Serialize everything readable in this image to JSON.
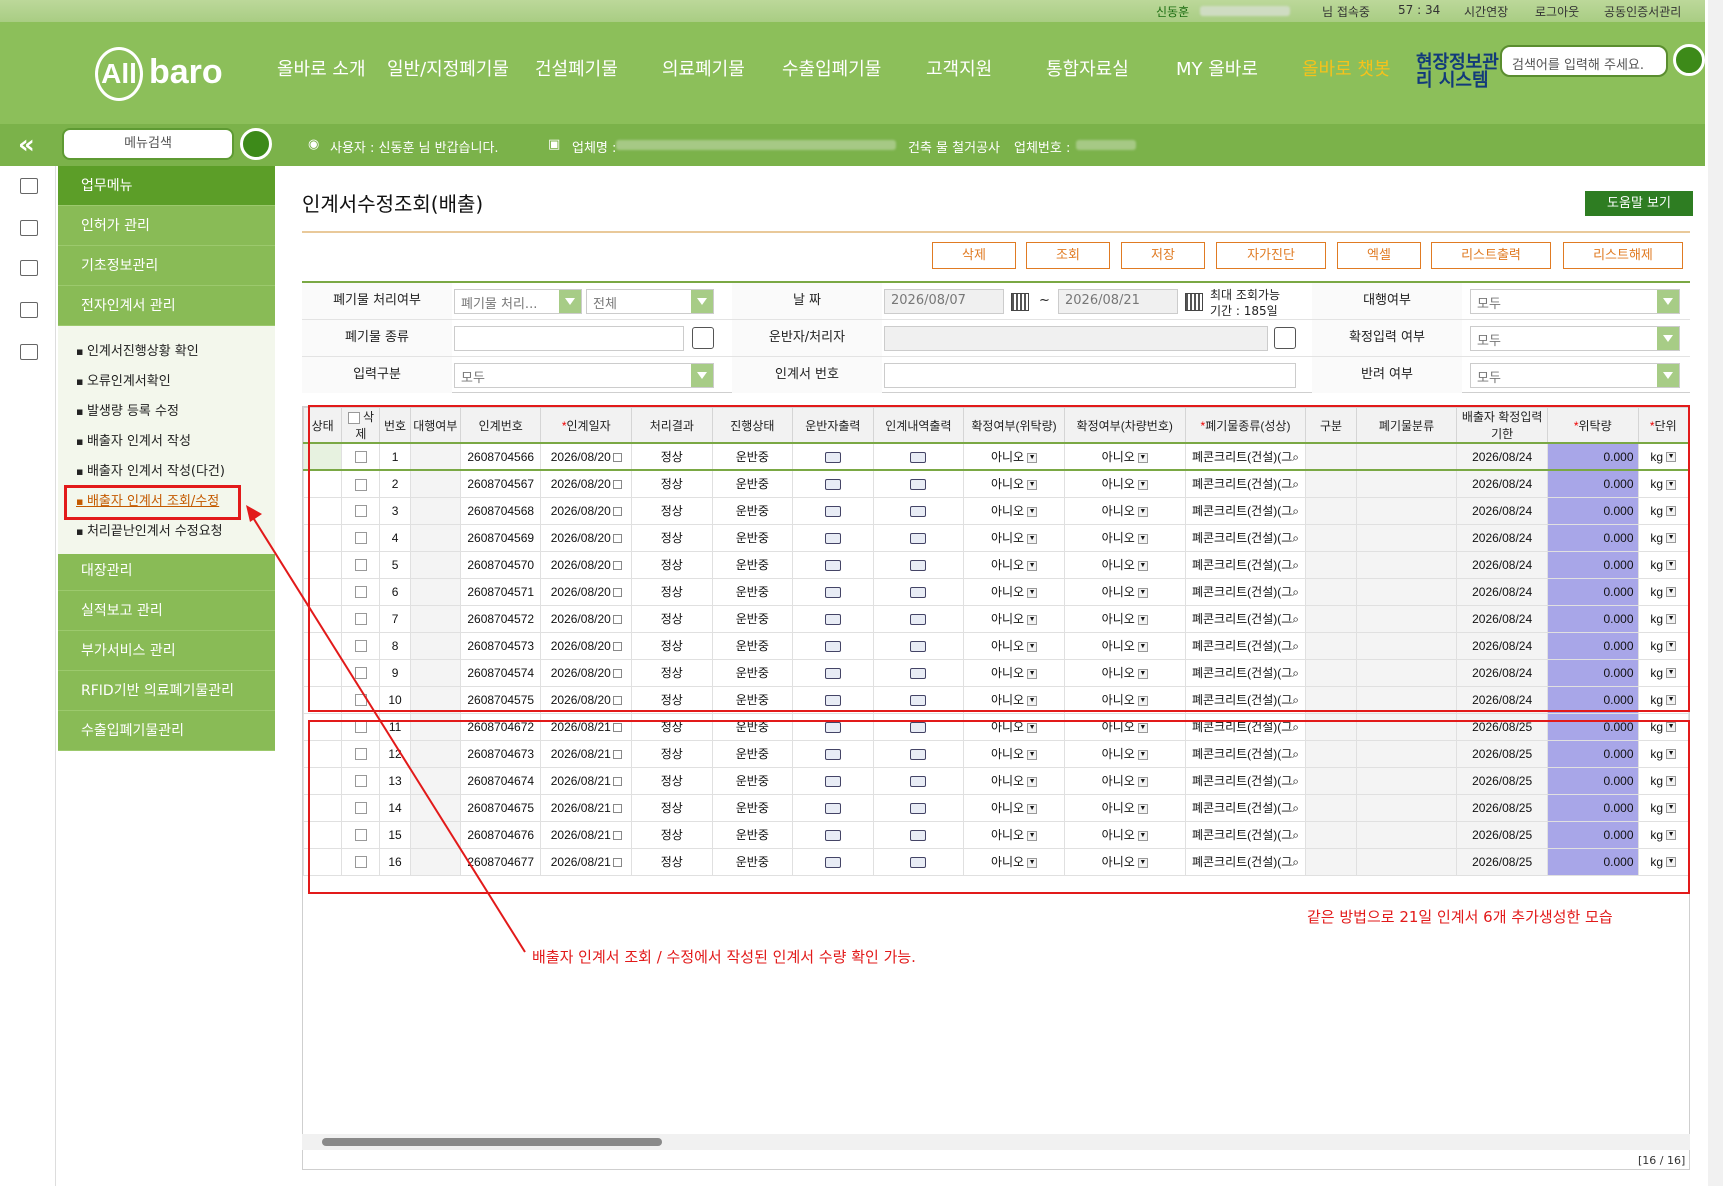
{
  "topbar": {
    "user": "신동훈",
    "status": "님 접속중",
    "timer": "57 : 34",
    "extend": "시간연장",
    "logout": "로그아웃",
    "cert": "공동인증서관리"
  },
  "logo": {
    "text": "baro",
    "mark": "All"
  },
  "nav": [
    "올바로 소개",
    "일반/지정폐기물",
    "건설폐기물",
    "의료폐기물",
    "수출입폐기물",
    "고객지원",
    "통합자료실",
    "MY 올바로",
    "올바로 챗봇",
    "현장정보관리 시스템"
  ],
  "search": {
    "placeholder": "검색어를 입력해 주세요."
  },
  "subbar": {
    "menu_search": "메뉴검색",
    "user_label": "사용자 : 신동훈 님 반갑습니다.",
    "company_label": "업체명 :",
    "company_tail": "건축 물 철거공사",
    "bizno_label": "업체번호 :"
  },
  "leftmenu": {
    "head": "업무메뉴",
    "items": [
      "인허가 관리",
      "기초정보관리",
      "전자인계서 관리"
    ],
    "sub": [
      "인계서진행상황 확인",
      "오류인계서확인",
      "발생량 등록 수정",
      "배출자 인계서 작성",
      "배출자 인계서 작성(다건)",
      "배출자 인계서 조회/수정",
      "처리끝난인계서 수정요청"
    ],
    "bottom": [
      "대장관리",
      "실적보고 관리",
      "부가서비스 관리",
      "RFID기반 의료폐기물관리",
      "수출입폐기물관리"
    ]
  },
  "page": {
    "title": "인계서수정조회(배출)",
    "help": "도움말 보기"
  },
  "actions": [
    "삭제",
    "조회",
    "저장",
    "자가진단",
    "엑셀",
    "리스트출력",
    "리스트해제"
  ],
  "filters": {
    "row1": {
      "l1": "폐기물 처리여부",
      "v1": "폐기물 처리...",
      "v1b": "전체",
      "l2": "날 짜",
      "date_from": "2026/08/07",
      "tilde": "~",
      "date_to": "2026/08/21",
      "max_period": "최대 조회가능",
      "max_period2": "기간 : 185일",
      "l3": "대행여부",
      "v3": "모두"
    },
    "row2": {
      "l1": "폐기물 종류",
      "l2": "운반자/처리자",
      "l3": "확정입력 여부",
      "v3": "모두"
    },
    "row3": {
      "l1": "입력구분",
      "v1": "모두",
      "l2": "인계서 번호",
      "l3": "반려 여부",
      "v3": "모두"
    }
  },
  "grid": {
    "headers": [
      "상태",
      "삭제",
      "번호",
      "대행여부",
      "인계번호",
      "인계일자",
      "처리결과",
      "진행상태",
      "운반자출력",
      "인계내역출력",
      "확정여부(위탁량)",
      "확정여부(차량번호)",
      "폐기물종류(성상)",
      "구분",
      "폐기물분류",
      "배출자 확정입력기한",
      "위탁량",
      "단위"
    ],
    "required_mark": "*",
    "rows": [
      {
        "no": "1",
        "id": "2608704566",
        "date": "2026/08/20",
        "result": "정상",
        "state": "운반중",
        "c1": "아니오",
        "c2": "아니오",
        "waste": "폐콘크리트(건설)(그",
        "deadline": "2026/08/24",
        "qty": "0.000",
        "unit": "kg"
      },
      {
        "no": "2",
        "id": "2608704567",
        "date": "2026/08/20",
        "result": "정상",
        "state": "운반중",
        "c1": "아니오",
        "c2": "아니오",
        "waste": "폐콘크리트(건설)(그",
        "deadline": "2026/08/24",
        "qty": "0.000",
        "unit": "kg"
      },
      {
        "no": "3",
        "id": "2608704568",
        "date": "2026/08/20",
        "result": "정상",
        "state": "운반중",
        "c1": "아니오",
        "c2": "아니오",
        "waste": "폐콘크리트(건설)(그",
        "deadline": "2026/08/24",
        "qty": "0.000",
        "unit": "kg"
      },
      {
        "no": "4",
        "id": "2608704569",
        "date": "2026/08/20",
        "result": "정상",
        "state": "운반중",
        "c1": "아니오",
        "c2": "아니오",
        "waste": "폐콘크리트(건설)(그",
        "deadline": "2026/08/24",
        "qty": "0.000",
        "unit": "kg"
      },
      {
        "no": "5",
        "id": "2608704570",
        "date": "2026/08/20",
        "result": "정상",
        "state": "운반중",
        "c1": "아니오",
        "c2": "아니오",
        "waste": "폐콘크리트(건설)(그",
        "deadline": "2026/08/24",
        "qty": "0.000",
        "unit": "kg"
      },
      {
        "no": "6",
        "id": "2608704571",
        "date": "2026/08/20",
        "result": "정상",
        "state": "운반중",
        "c1": "아니오",
        "c2": "아니오",
        "waste": "폐콘크리트(건설)(그",
        "deadline": "2026/08/24",
        "qty": "0.000",
        "unit": "kg"
      },
      {
        "no": "7",
        "id": "2608704572",
        "date": "2026/08/20",
        "result": "정상",
        "state": "운반중",
        "c1": "아니오",
        "c2": "아니오",
        "waste": "폐콘크리트(건설)(그",
        "deadline": "2026/08/24",
        "qty": "0.000",
        "unit": "kg"
      },
      {
        "no": "8",
        "id": "2608704573",
        "date": "2026/08/20",
        "result": "정상",
        "state": "운반중",
        "c1": "아니오",
        "c2": "아니오",
        "waste": "폐콘크리트(건설)(그",
        "deadline": "2026/08/24",
        "qty": "0.000",
        "unit": "kg"
      },
      {
        "no": "9",
        "id": "2608704574",
        "date": "2026/08/20",
        "result": "정상",
        "state": "운반중",
        "c1": "아니오",
        "c2": "아니오",
        "waste": "폐콘크리트(건설)(그",
        "deadline": "2026/08/24",
        "qty": "0.000",
        "unit": "kg"
      },
      {
        "no": "10",
        "id": "2608704575",
        "date": "2026/08/20",
        "result": "정상",
        "state": "운반중",
        "c1": "아니오",
        "c2": "아니오",
        "waste": "폐콘크리트(건설)(그",
        "deadline": "2026/08/24",
        "qty": "0.000",
        "unit": "kg"
      },
      {
        "no": "11",
        "id": "2608704672",
        "date": "2026/08/21",
        "result": "정상",
        "state": "운반중",
        "c1": "아니오",
        "c2": "아니오",
        "waste": "폐콘크리트(건설)(그",
        "deadline": "2026/08/25",
        "qty": "0.000",
        "unit": "kg"
      },
      {
        "no": "12",
        "id": "2608704673",
        "date": "2026/08/21",
        "result": "정상",
        "state": "운반중",
        "c1": "아니오",
        "c2": "아니오",
        "waste": "폐콘크리트(건설)(그",
        "deadline": "2026/08/25",
        "qty": "0.000",
        "unit": "kg"
      },
      {
        "no": "13",
        "id": "2608704674",
        "date": "2026/08/21",
        "result": "정상",
        "state": "운반중",
        "c1": "아니오",
        "c2": "아니오",
        "waste": "폐콘크리트(건설)(그",
        "deadline": "2026/08/25",
        "qty": "0.000",
        "unit": "kg"
      },
      {
        "no": "14",
        "id": "2608704675",
        "date": "2026/08/21",
        "result": "정상",
        "state": "운반중",
        "c1": "아니오",
        "c2": "아니오",
        "waste": "폐콘크리트(건설)(그",
        "deadline": "2026/08/25",
        "qty": "0.000",
        "unit": "kg"
      },
      {
        "no": "15",
        "id": "2608704676",
        "date": "2026/08/21",
        "result": "정상",
        "state": "운반중",
        "c1": "아니오",
        "c2": "아니오",
        "waste": "폐콘크리트(건설)(그",
        "deadline": "2026/08/25",
        "qty": "0.000",
        "unit": "kg"
      },
      {
        "no": "16",
        "id": "2608704677",
        "date": "2026/08/21",
        "result": "정상",
        "state": "운반중",
        "c1": "아니오",
        "c2": "아니오",
        "waste": "폐콘크리트(건설)(그",
        "deadline": "2026/08/25",
        "qty": "0.000",
        "unit": "kg"
      }
    ]
  },
  "pager": "[16 / 16]",
  "annotations": {
    "right": "같은 방법으로 21일 인계서 6개 추가생성한 모습",
    "bottom": "배출자 인계서 조회 / 수정에서 작성된 인계서 수량 확인 가능."
  },
  "colors": {
    "brand_green": "#8cbf5a",
    "accent_orange": "#e07b23",
    "annotation_red": "#e21a1a",
    "qty_blue": "#a8a6e8"
  }
}
